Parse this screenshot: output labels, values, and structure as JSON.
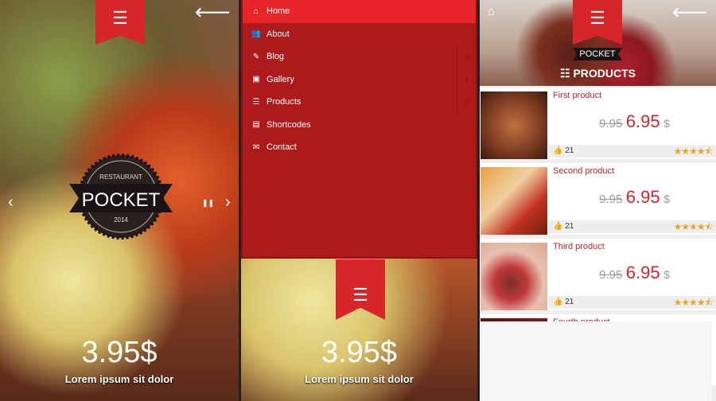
{
  "colors": {
    "accent": "#d7262a",
    "menu_bg": "#ad1a1c",
    "star": "#e8a423"
  },
  "screen1": {
    "menu_icon": "☰",
    "back_icon": "🡐",
    "logo": {
      "top": "RESTAURANT",
      "name": "POCKET",
      "year": "2014"
    },
    "prev": "‹",
    "next": "›",
    "pause": "❚❚",
    "price": "3.95$",
    "caption": "Lorem ipsum sit dolor"
  },
  "screen2": {
    "menu": [
      {
        "label": "Home",
        "icon": "home-icon",
        "glyph": "⌂",
        "active": true
      },
      {
        "label": "About",
        "icon": "users-icon",
        "glyph": "👥"
      },
      {
        "label": "Blog",
        "icon": "edit-icon",
        "glyph": "✎",
        "sub": true
      },
      {
        "label": "Gallery",
        "icon": "image-icon",
        "glyph": "▣",
        "sub": true
      },
      {
        "label": "Products",
        "icon": "list-icon",
        "glyph": "☰",
        "sub": true
      },
      {
        "label": "Shortcodes",
        "icon": "window-icon",
        "glyph": "▤"
      },
      {
        "label": "Contact",
        "icon": "envelope-icon",
        "glyph": "✉"
      }
    ],
    "chevron": "›",
    "menu_icon": "☰",
    "price": "3.95$",
    "caption": "Lorem ipsum sit dolor"
  },
  "screen3": {
    "home_icon": "⌂",
    "menu_icon": "☰",
    "back_icon": "🡐",
    "logo": "POCKET",
    "title": "PRODUCTS",
    "title_icon": "☷",
    "products": [
      {
        "name": "First product",
        "old_price": "9.95",
        "price": "6.95",
        "currency": "$",
        "likes": "21",
        "rating": 4.5
      },
      {
        "name": "Second product",
        "old_price": "9.95",
        "price": "6.95",
        "currency": "$",
        "likes": "21",
        "rating": 4.5
      },
      {
        "name": "Third product",
        "old_price": "9.95",
        "price": "6.95",
        "currency": "$",
        "likes": "21",
        "rating": 4.5
      },
      {
        "name": "Fourth product"
      }
    ],
    "stars": "★★★★⯪",
    "like_icon": "👍"
  }
}
